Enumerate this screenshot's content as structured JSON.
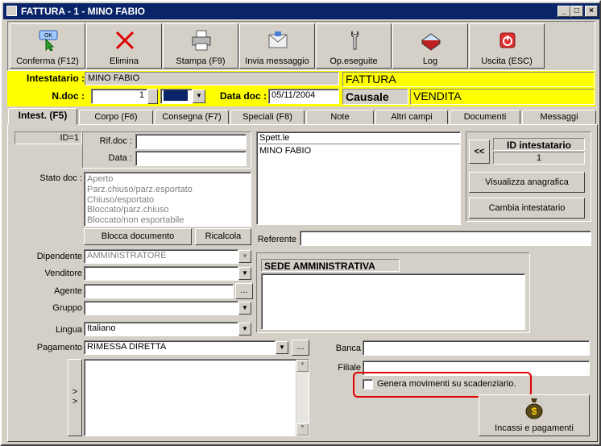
{
  "window": {
    "title": "FATTURA - 1  - MINO FABIO"
  },
  "toolbar": [
    {
      "label": "Conferma (F12)",
      "icon": "check-ok-icon"
    },
    {
      "label": "Elimina",
      "icon": "delete-x-icon"
    },
    {
      "label": "Stampa (F9)",
      "icon": "printer-icon"
    },
    {
      "label": "Invia messaggio",
      "icon": "envelope-icon"
    },
    {
      "label": "Op.eseguite",
      "icon": "wrench-icon"
    },
    {
      "label": "Log",
      "icon": "book-icon"
    },
    {
      "label": "Uscita (ESC)",
      "icon": "power-icon"
    }
  ],
  "toolbar_ok_badge": "OK",
  "header": {
    "intestatario_label": "Intestatario :",
    "intestatario_value": "MINO FABIO",
    "doc_type": "FATTURA",
    "ndoc_label": "N.doc :",
    "ndoc_value": "1",
    "datadoc_label": "Data doc :",
    "datadoc_value": "05/11/2004",
    "causale_label": "Causale",
    "causale_value": "VENDITA"
  },
  "tabs": [
    "Intest. (F5)",
    "Corpo (F6)",
    "Consegna (F7)",
    "Speciali (F8)",
    "Note",
    "Altri campi",
    "Documenti",
    "Messaggi"
  ],
  "active_tab": 0,
  "form": {
    "id_text": "ID=1",
    "rifdoc_label": "Rif.doc :",
    "rifdoc_value": "",
    "data_label": "Data :",
    "data_value": "",
    "stato_label": "Stato doc :",
    "stato_options": [
      "Aperto",
      "Parz.chiuso/parz.esportato",
      "Chiuso/esportato",
      "Bloccato/parz.chiuso",
      "Bloccato/non esportabile"
    ],
    "blocca_button": "Blocca documento",
    "ricalcola_button": "Ricalcola",
    "spett": "Spett.le",
    "address_name": "MINO FABIO",
    "back_button": "<<",
    "id_intestatario_label": "ID intestatario",
    "id_intestatario_value": "1",
    "visualizza_button": "Visualizza anagrafica",
    "cambia_button": "Cambia intestatario",
    "referente_label": "Referente",
    "referente_value": "",
    "dipendente_label": "Dipendente",
    "dipendente_value": "AMMINISTRATORE",
    "venditore_label": "Venditore",
    "venditore_value": "",
    "agente_label": "Agente",
    "agente_value": "",
    "gruppo_label": "Gruppo",
    "gruppo_value": "",
    "lingua_label": "Lingua",
    "lingua_value": "Italiano",
    "pagamento_label": "Pagamento",
    "pagamento_value": "RIMESSA DIRETTA",
    "ellipsis": "...",
    "sede_title": "SEDE AMMINISTRATIVA",
    "banca_label": "Banca",
    "banca_value": "",
    "filiale_label": "Filiale",
    "filiale_value": "",
    "genera_label": "Genera movimenti su scadenziario.",
    "genera_checked": false,
    "incassi_button": "Incassi e pagamenti",
    "incassi_icon_glyph": "$",
    "side_arrows": ">\n>"
  }
}
